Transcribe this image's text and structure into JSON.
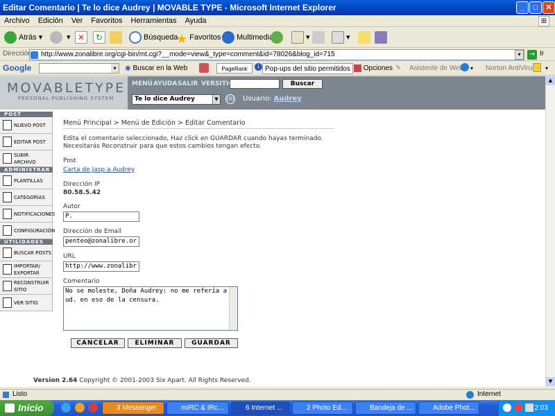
{
  "window": {
    "title": "Editar Comentario | Te lo dice Audrey | MOVABLE TYPE - Microsoft Internet Explorer",
    "minimize": "_",
    "maximize": "□",
    "close": "✕"
  },
  "menu": [
    "Archivo",
    "Edición",
    "Ver",
    "Favoritos",
    "Herramientas",
    "Ayuda"
  ],
  "toolbar": {
    "back": "Atrás",
    "search": "Búsqueda",
    "favorites": "Favoritos",
    "media": "Multimedia"
  },
  "address": {
    "label": "Dirección",
    "url": "http://www.zonalibre.org/cgi-bin/mt.cgi?__mode=view&_type=comment&id=78026&blog_id=715",
    "go": "Ir"
  },
  "googlebar": {
    "logo": "Google",
    "search_web": "Buscar en la Web",
    "pagerank": "PageRank",
    "popups": "Pop-ups del sitio permitidos",
    "options": "Opciones",
    "web_assistant": "Asistente de Web",
    "antivirus": "Norton AntiVirus"
  },
  "mt": {
    "logo_main": "MOVABLETYPE",
    "logo_sub": "PERSONAL PUBLISHING SYSTEM",
    "nav": [
      "MENÚ",
      "AYUDA",
      "SALIR",
      "VERSITIO"
    ],
    "search_button": "Buscar",
    "blog_selected": "Te lo dice Audrey",
    "user_label": "Usuario:",
    "user_name": "Audrey"
  },
  "sidebar": {
    "sections": [
      {
        "head": "POST",
        "items": [
          "NUEVO POST",
          "EDITAR POST",
          "SUBIR ARCHIVO"
        ]
      },
      {
        "head": "ADMINISTRAR",
        "items": [
          "PLANTILLAS",
          "CATEGORÍAS",
          "NOTIFICACIONES",
          "CONFIGURACIÓN"
        ]
      },
      {
        "head": "UTILIDADES",
        "items": [
          "BUSCAR POSTS",
          "IMPORTAR/ EXPORTAR",
          "RECONSTRUIR SITIO",
          "VER SITIO"
        ]
      }
    ]
  },
  "breadcrumb": {
    "menu_principal": "Menú Principal",
    "sep1": " > ",
    "menu_edicion": "Menú de Edición",
    "sep2": " > ",
    "current": "Editar Comentario"
  },
  "form": {
    "intro1": "Edita el comentario seleccionado, Haz click en GUARDAR cuando hayas terminado.",
    "intro2": "Necesitarás Reconstruir para que estos cambios tengan efecto.",
    "post_label": "Post",
    "post_link": "Carta de Jasp a Audrey",
    "ip_label": "Dirección IP",
    "ip_value": "80.58.5.42",
    "author_label": "Autor",
    "author_value": "P.",
    "email_label": "Dirección de Email",
    "email_value": "penteo@zonalibre.or",
    "url_label": "URL",
    "url_value": "http://www.zonalibr",
    "comment_label": "Comentario",
    "comment_value": "No se moleste, Doña Audrey: no me refería a ud. en eso de la censura.",
    "cancel": "CANCELAR",
    "delete": "ELIMINAR",
    "save": "GUARDAR"
  },
  "footer": {
    "version": "Version 2.64",
    "copyright": " Copyright © 2001-2003 Six Apart. All Rights Reserved."
  },
  "status": {
    "left": "Listo",
    "zone": "Internet"
  },
  "taskbar": {
    "start": "Inicio",
    "tasks": [
      "3 Messenger",
      "mIRC & IRc...",
      "6 Internet ...",
      "2 Photo Ed...",
      "Bandeja de ...",
      "Adobe Phot..."
    ],
    "clock": "2:03"
  }
}
